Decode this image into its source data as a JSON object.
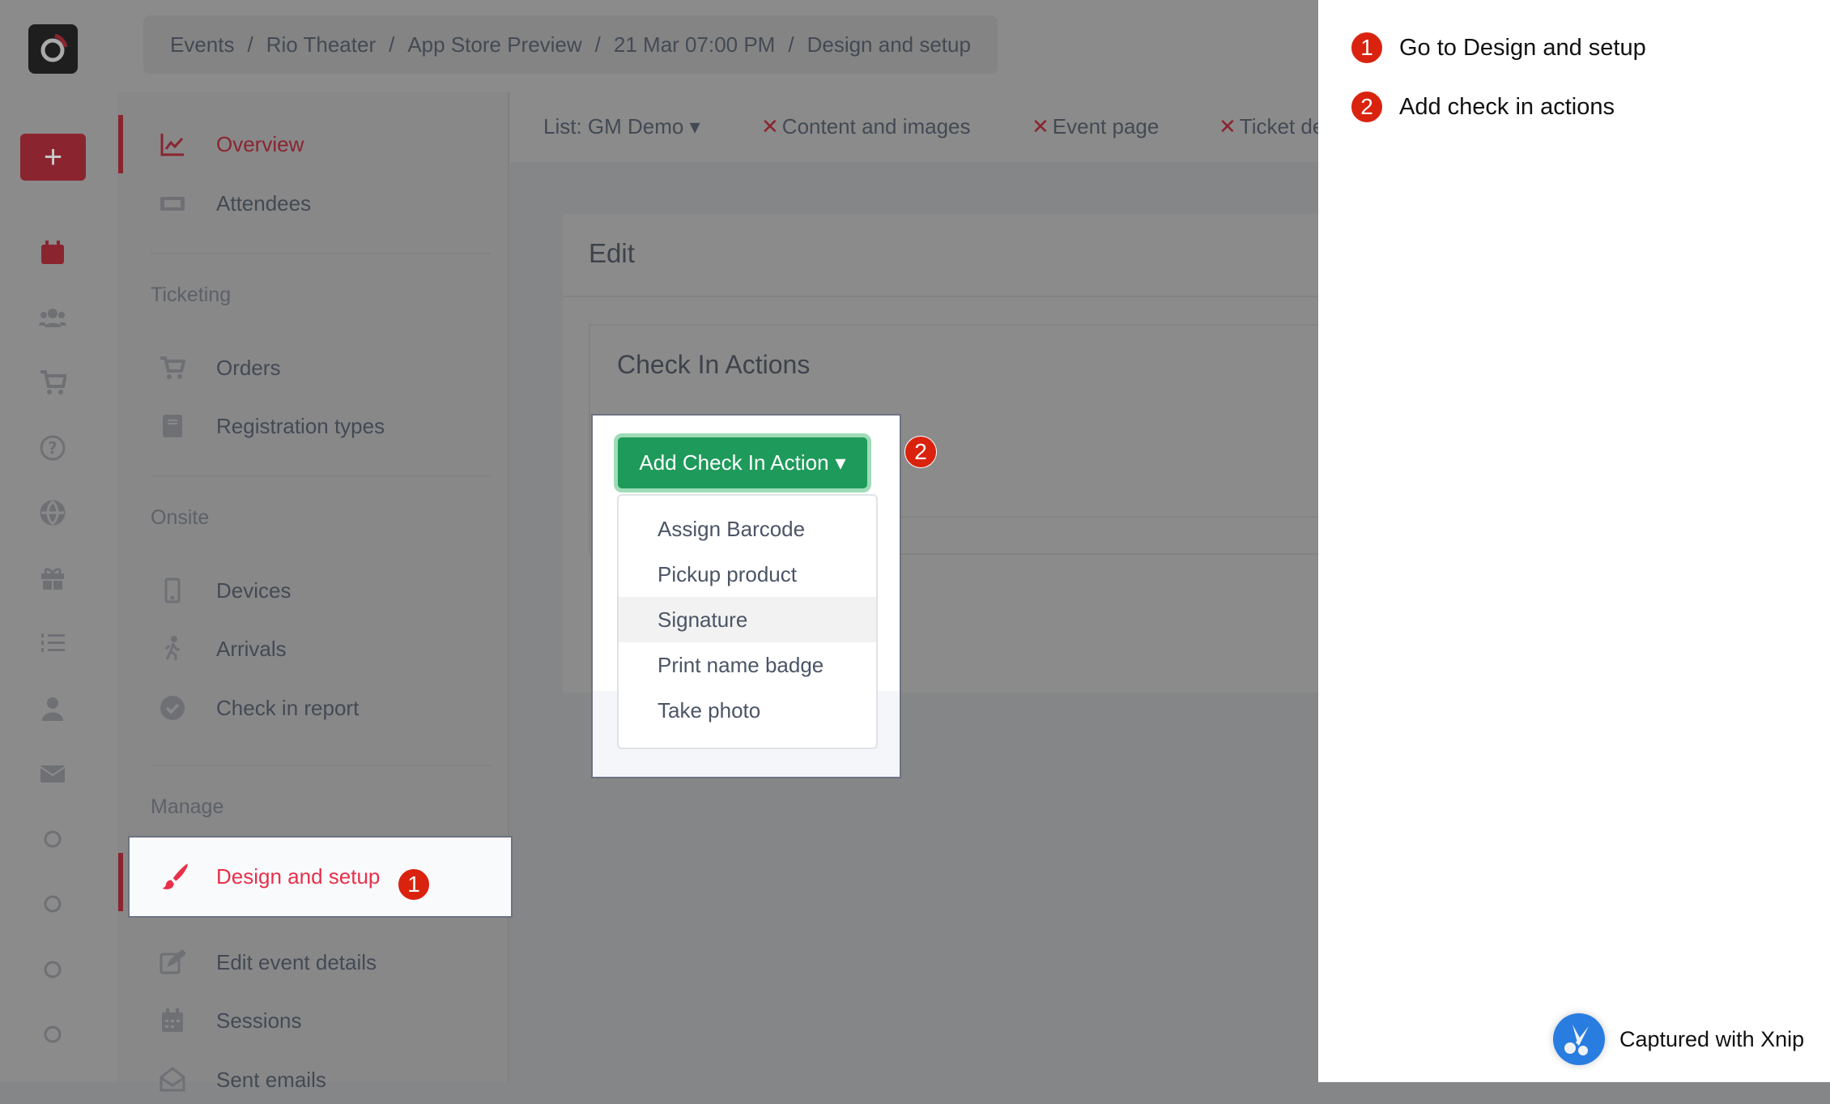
{
  "breadcrumb": [
    "Events",
    "Rio Theater",
    "App Store Preview",
    "21 Mar 07:00 PM",
    "Design and setup"
  ],
  "breadcrumb_separator": "/",
  "rail": {
    "add_label": "+",
    "icons": [
      "calendar-icon",
      "users-icon",
      "cart-icon",
      "question-icon",
      "globe-icon",
      "gift-icon",
      "ordered-list-icon",
      "user-icon",
      "envelope-icon",
      "circle-icon",
      "circle-icon",
      "circle-icon",
      "circle-icon"
    ]
  },
  "nav": {
    "overview": "Overview",
    "attendees": "Attendees",
    "ticketing": "Ticketing",
    "orders": "Orders",
    "registration_types": "Registration types",
    "onsite": "Onsite",
    "devices": "Devices",
    "arrivals": "Arrivals",
    "check_in_report": "Check in report",
    "manage": "Manage",
    "design_and_setup": "Design and setup",
    "edit_event_details": "Edit event details",
    "sessions": "Sessions",
    "sent_emails": "Sent emails"
  },
  "tabs": {
    "list": "List: GM Demo",
    "content": "Content and images",
    "event_page": "Event page",
    "ticket": "Ticket de",
    "x": "✕",
    "caret": "▾"
  },
  "edit": {
    "title": "Edit",
    "section": "Check In Actions"
  },
  "button": {
    "label": "Add Check In Action",
    "caret": "▾"
  },
  "dropdown": {
    "items": [
      "Assign Barcode",
      "Pickup product",
      "Signature",
      "Print name badge",
      "Take photo"
    ],
    "highlighted": "Signature"
  },
  "annotations": {
    "badge1": "1",
    "badge2": "2",
    "steps": [
      {
        "num": "1",
        "text": "Go to Design and setup"
      },
      {
        "num": "2",
        "text": "Add check in actions"
      }
    ]
  },
  "watermark": "Captured with Xnip",
  "colors": {
    "accent": "#e8304a",
    "brand_dark": "#8a2530",
    "button": "#1e9a5b",
    "badge": "#d9230f"
  }
}
